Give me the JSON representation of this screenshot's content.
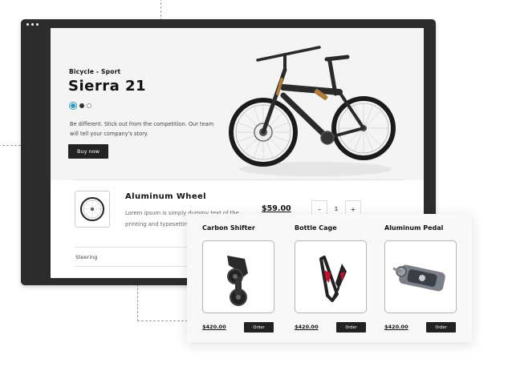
{
  "hero": {
    "subtitle": "Bicycle - Sport",
    "title": "Sierra 21",
    "description": "Be different. Stick out from the competition. Our team will tell your company's story.",
    "buy_label": "Buy now",
    "color_swatches": [
      "#2f9bbf",
      "#333333",
      "#ffffff"
    ]
  },
  "line_item": {
    "name": "Aluminum  Wheel",
    "description": "Lorem ipsum is simply dummy text of the printing and typesetting",
    "price": "$59.00",
    "quantity": "1",
    "minus_label": "–",
    "plus_label": "+"
  },
  "category": {
    "label": "Steering"
  },
  "products": [
    {
      "name": "Carbon Shifter",
      "price": "$420.00",
      "button": "Order"
    },
    {
      "name": "Bottle Cage",
      "price": "$420.00",
      "button": "Order"
    },
    {
      "name": "Aluminum Pedal",
      "price": "$420.00",
      "button": "Order"
    }
  ]
}
